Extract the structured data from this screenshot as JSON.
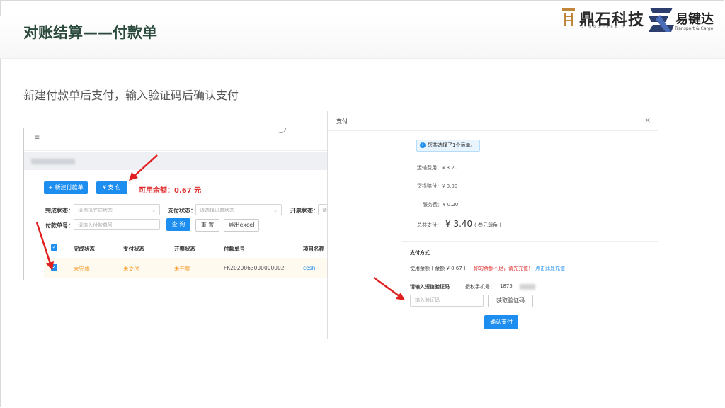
{
  "slide": {
    "title": "对账结算——付款单",
    "subtitle": "新建付款单后支付，输入验证码后确认支付",
    "logo1": {
      "name": "鼎石科技",
      "sub": "DINGSHIKEJI"
    },
    "logo2": {
      "name": "易键达",
      "sub": "Transport & Cargo"
    }
  },
  "colors": {
    "accent": "#1d8df0",
    "warning": "#e03131",
    "title": "#2b4a3c",
    "status_orange": "#f59a23",
    "arrow": "#e02020"
  },
  "list_page": {
    "menu_icon": "menu-fold-icon",
    "buttons": {
      "new": "+ 新建付款单",
      "pay": "¥ 支 付"
    },
    "balance_label": "可用余额：0.67 元",
    "filters": {
      "complete_status_label": "完成状态：",
      "complete_status_placeholder": "请选择完成状态",
      "pay_status_label": "支付状态：",
      "pay_status_placeholder": "请选择订单状态",
      "invoice_status_label": "开票状态：",
      "invoice_status_placeholder": "请",
      "payment_no_label": "付款单号：",
      "payment_no_placeholder": "请输入付款单号",
      "query": "查 询",
      "reset": "重 置",
      "export": "导出excel"
    },
    "table": {
      "headers": [
        "完成状态",
        "支付状态",
        "开票状态",
        "付款单号",
        "项目名称"
      ],
      "rows": [
        {
          "complete": "未完成",
          "pay": "未支付",
          "invoice": "未开票",
          "no": "FK2020063000000002",
          "project": "ceshi"
        }
      ]
    }
  },
  "pay_modal": {
    "title": "支付",
    "close": "×",
    "tip": "您共选择了1个运单。",
    "freight": "运输费用：¥ 3.20",
    "damage": "货损赔付：¥ 0.00",
    "service": "服务费：¥ 0.20",
    "total_label": "总共支付：",
    "total_value": "¥ 3.40",
    "total_words": "( 叁元肆角 )",
    "method_title": "支付方式",
    "use_balance": "使用余额 ( 余额 ¥ 0.67 )",
    "insufficient": "你的余额不足，请先充值！",
    "recharge_link": "点击此处充值",
    "sms_label": "请输入短信验证码",
    "phone_label": "授权手机号：",
    "phone_value": "1875",
    "code_placeholder": "输入验证码",
    "get_code": "获取验证码",
    "confirm": "确认支付"
  }
}
